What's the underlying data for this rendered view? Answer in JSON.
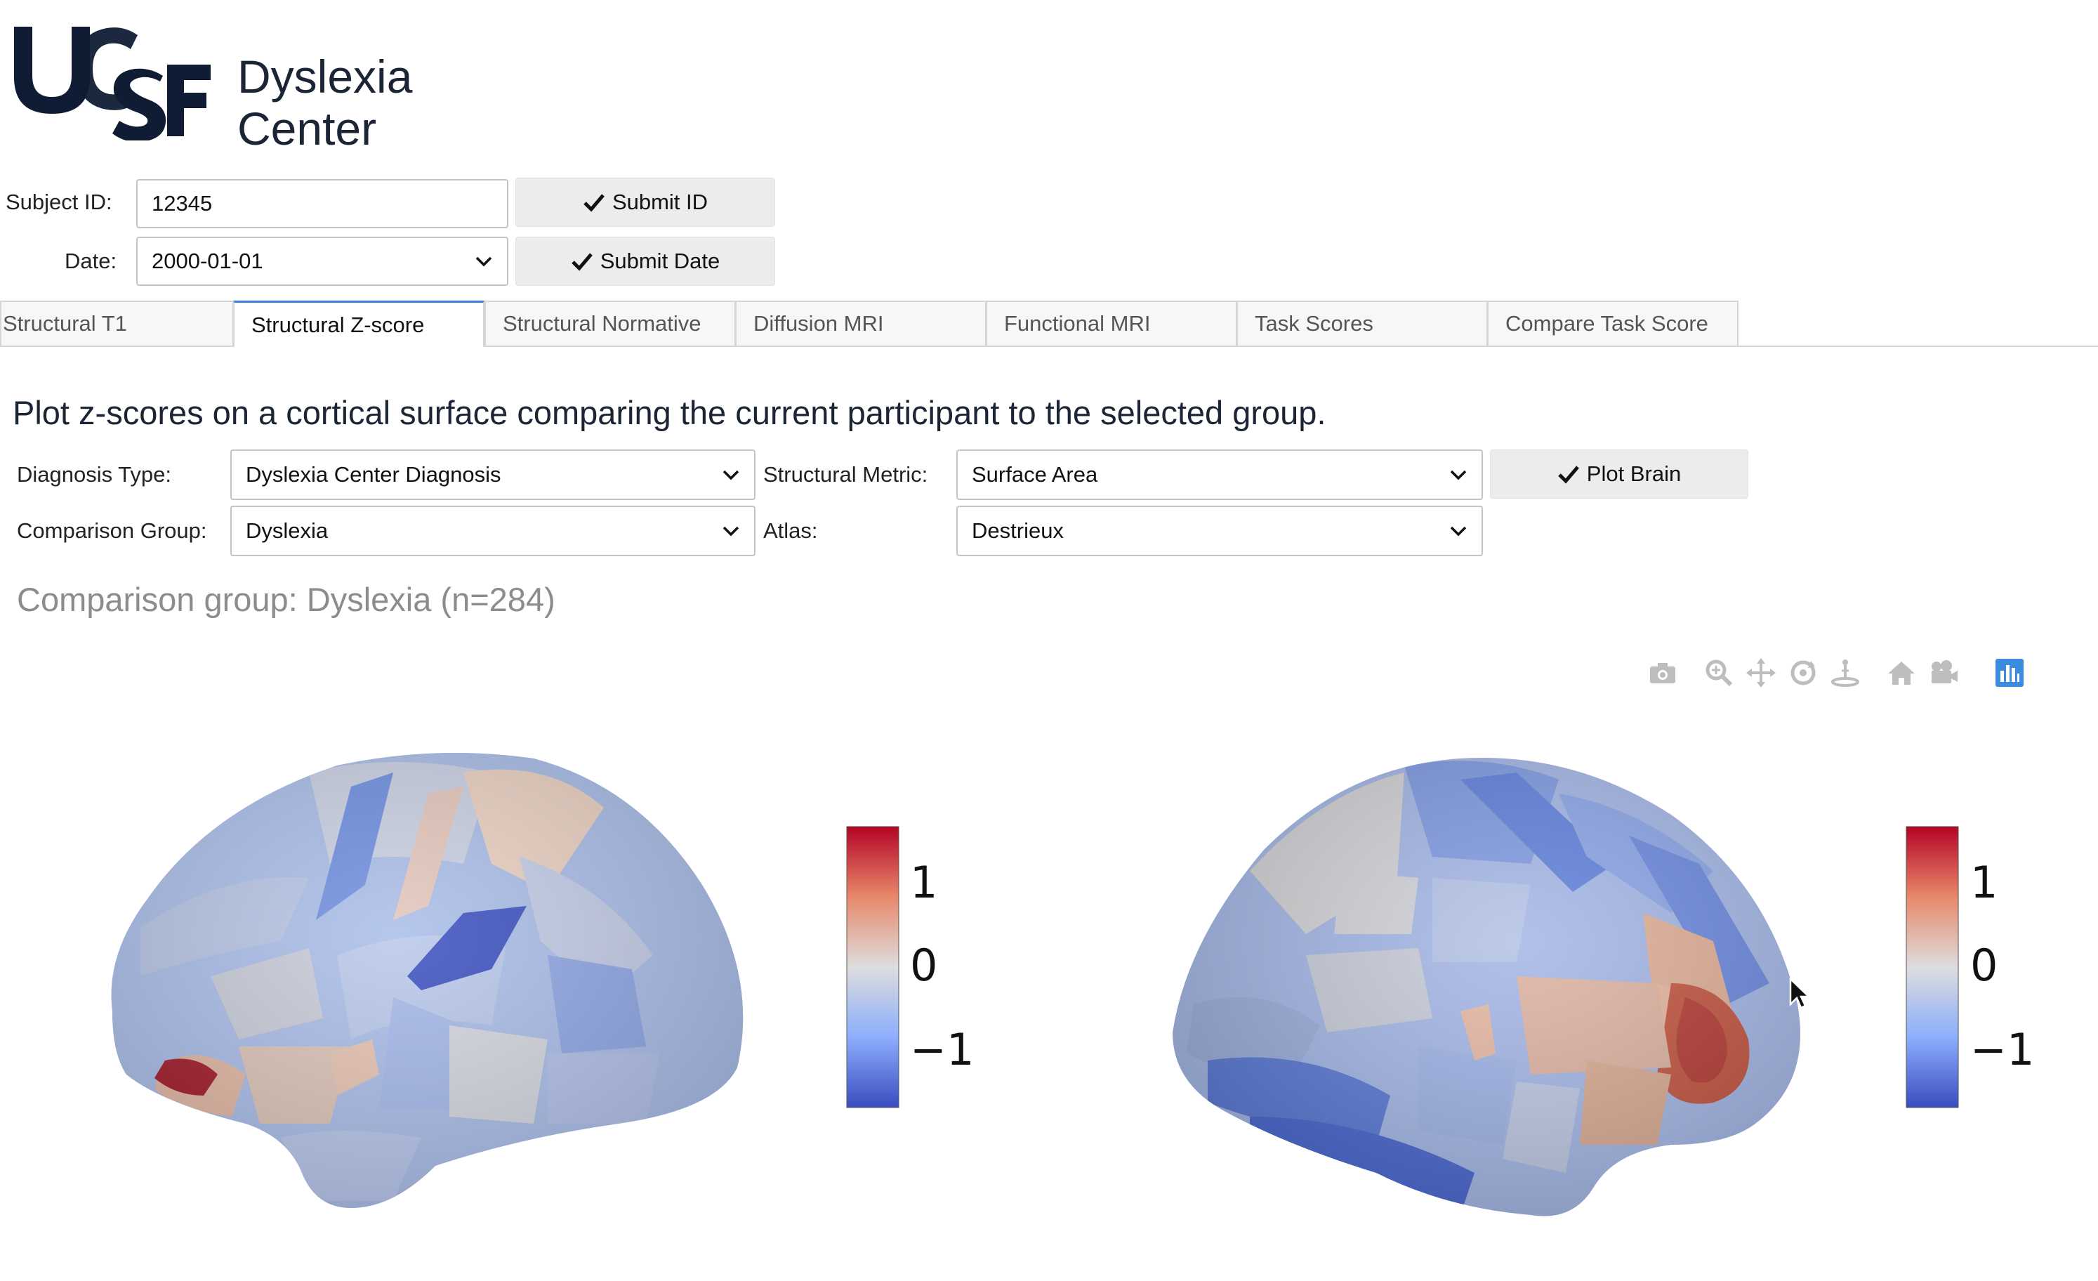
{
  "logo": {
    "mark_text": "UCSF",
    "name_line1": "Dyslexia",
    "name_line2": "Center"
  },
  "subject": {
    "label": "Subject ID:",
    "value": "12345",
    "submit_label": "Submit ID"
  },
  "date": {
    "label": "Date:",
    "value": "2000-01-01",
    "submit_label": "Submit Date"
  },
  "tabs": [
    {
      "label": "Structural T1"
    },
    {
      "label": "Structural Z-score",
      "active": true
    },
    {
      "label": "Structural Normative"
    },
    {
      "label": "Diffusion MRI"
    },
    {
      "label": "Functional MRI"
    },
    {
      "label": "Task Scores"
    },
    {
      "label": "Compare Task Score"
    }
  ],
  "headline": "Plot z-scores on a cortical surface comparing the current participant to the selected group.",
  "controls": {
    "diagnosis_label": "Diagnosis Type:",
    "diagnosis_value": "Dyslexia Center Diagnosis",
    "group_label": "Comparison Group:",
    "group_value": "Dyslexia",
    "metric_label": "Structural Metric:",
    "metric_value": "Surface Area",
    "atlas_label": "Atlas:",
    "atlas_value": "Destrieux",
    "plot_label": "Plot Brain"
  },
  "group_title": "Comparison group: Dyslexia (n=284)",
  "modebar": [
    "camera-icon",
    "zoom-icon",
    "pan-icon",
    "orbit-icon",
    "turntable-icon",
    "home-icon",
    "reset-camera-icon",
    "plotly-logo-icon"
  ],
  "colorbar": {
    "ticks": [
      "1",
      "0",
      "−1"
    ],
    "range": [
      -1.6,
      1.6
    ],
    "colors": [
      "#3a4cc0",
      "#dddddd",
      "#b40426"
    ]
  }
}
